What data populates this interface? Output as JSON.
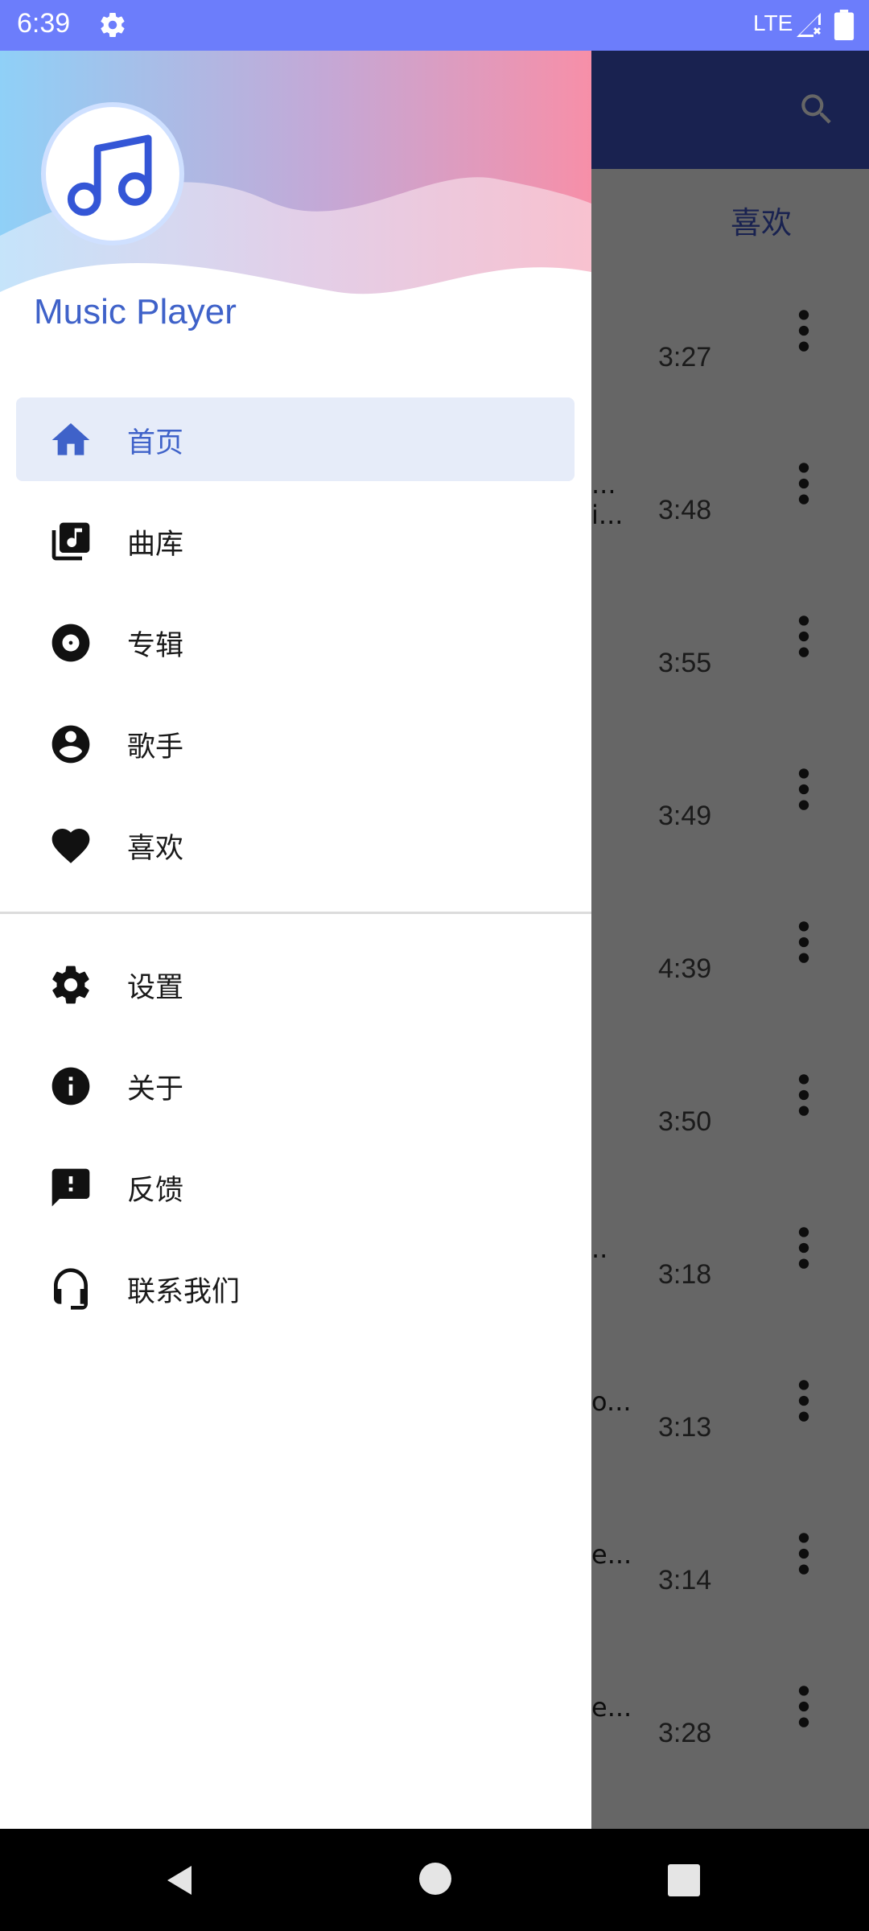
{
  "status_bar": {
    "time": "6:39",
    "network": "LTE"
  },
  "background_app": {
    "tab_label": "喜欢",
    "songs": [
      {
        "title_fragment": "",
        "duration": "3:27"
      },
      {
        "title_fragment": "...\ni...",
        "duration": "3:48"
      },
      {
        "title_fragment": "",
        "duration": "3:55"
      },
      {
        "title_fragment": "",
        "duration": "3:49"
      },
      {
        "title_fragment": "",
        "duration": "4:39"
      },
      {
        "title_fragment": "",
        "duration": "3:50"
      },
      {
        "title_fragment": "..",
        "duration": "3:18"
      },
      {
        "title_fragment": "o...",
        "duration": "3:13"
      },
      {
        "title_fragment": "e...",
        "duration": "3:14"
      },
      {
        "title_fragment": "e...",
        "duration": "3:28"
      }
    ]
  },
  "drawer": {
    "app_name": "Music Player",
    "primary_items": [
      {
        "label": "首页",
        "icon": "home-icon",
        "active": true
      },
      {
        "label": "曲库",
        "icon": "library-music-icon",
        "active": false
      },
      {
        "label": "专辑",
        "icon": "album-icon",
        "active": false
      },
      {
        "label": "歌手",
        "icon": "artist-icon",
        "active": false
      },
      {
        "label": "喜欢",
        "icon": "heart-icon",
        "active": false
      }
    ],
    "secondary_items": [
      {
        "label": "设置",
        "icon": "gear-icon"
      },
      {
        "label": "关于",
        "icon": "info-icon"
      },
      {
        "label": "反馈",
        "icon": "feedback-icon"
      },
      {
        "label": "联系我们",
        "icon": "headset-icon"
      }
    ]
  },
  "colors": {
    "status_bar": "#6c7dfb",
    "accent": "#3f62c9",
    "active_item_bg": "#e6ecf9",
    "app_bar": "#3f55c8"
  }
}
